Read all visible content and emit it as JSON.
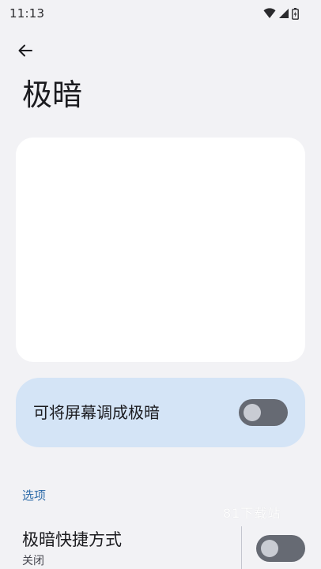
{
  "status_bar": {
    "time": "11:13",
    "icons": [
      "wifi-icon",
      "cellular-signal-icon",
      "battery-icon"
    ]
  },
  "header": {
    "back_icon": "arrow-back-icon",
    "title": "极暗"
  },
  "main_toggle": {
    "label": "可将屏幕调成极暗",
    "checked": false
  },
  "options_section": {
    "header": "选项",
    "shortcut": {
      "title": "极暗快捷方式",
      "summary": "关闭",
      "checked": false
    }
  },
  "watermark": "81下载站",
  "colors": {
    "background": "#f2f2f5",
    "card": "#ffffff",
    "toggle_card": "#d4e4f6",
    "accent": "#2f6ca8",
    "switch_track_off": "#666a73",
    "switch_thumb_off": "#c9ccd3"
  }
}
